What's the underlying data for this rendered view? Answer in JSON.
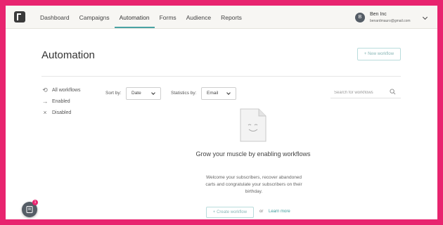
{
  "nav": {
    "items": [
      {
        "label": "Dashboard"
      },
      {
        "label": "Campaigns"
      },
      {
        "label": "Automation"
      },
      {
        "label": "Forms"
      },
      {
        "label": "Audience"
      },
      {
        "label": "Reports"
      }
    ],
    "active": "Automation"
  },
  "account": {
    "avatar_letter": "B",
    "name": "Ben Inc",
    "email": "benardmauro@gmail.com"
  },
  "page": {
    "title": "Automation",
    "new_workflow_label": "+ New workflow"
  },
  "filters": [
    {
      "label": "All workflows",
      "icon": "refresh-icon"
    },
    {
      "label": "Enabled",
      "icon": "arrow-right-icon"
    },
    {
      "label": "Disabled",
      "icon": "x-icon"
    }
  ],
  "controls": {
    "sort_label": "Sort by:",
    "sort_value": "Date",
    "stats_label": "Statistics by:",
    "stats_value": "Email",
    "search_placeholder": "Search for workflows"
  },
  "empty_state": {
    "title": "Grow your muscle by enabling workflows",
    "description": "Welcome your subscribers, recover abandoned carts and congratulate your subscribers on their birthday.",
    "create_label": "+ Create workflow",
    "or_text": "or",
    "learn_more": "Learn more"
  },
  "chat": {
    "badge": "1"
  },
  "colors": {
    "accent": "#4aa3a3",
    "frame": "#e8246f",
    "topbar": "#f7f6f3"
  }
}
